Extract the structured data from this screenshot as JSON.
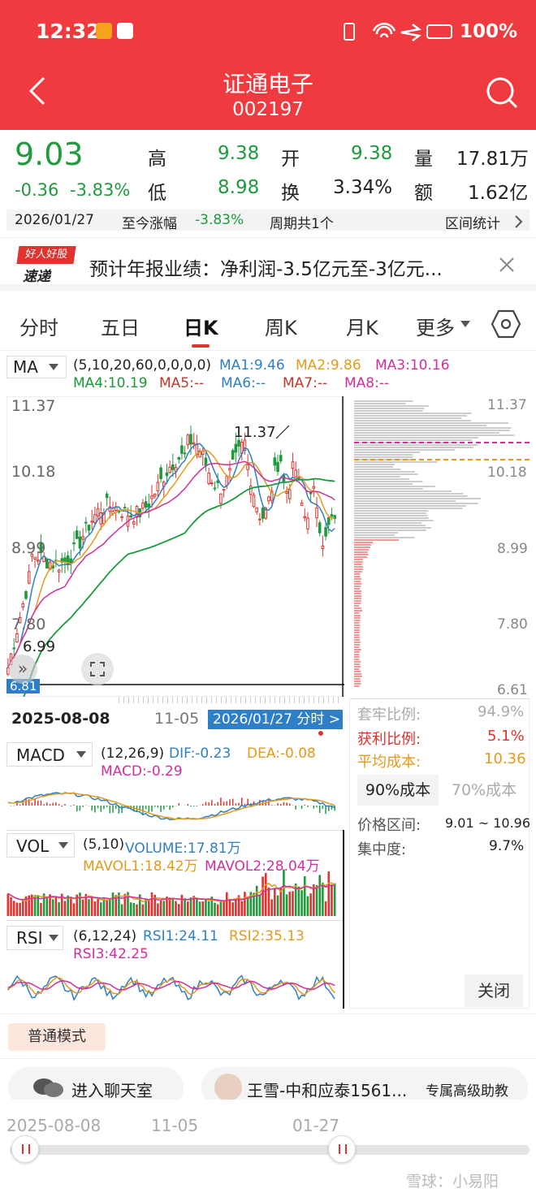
{
  "status": {
    "time": "12:32",
    "battery": "100%"
  },
  "header": {
    "title": "证通电子",
    "code": "002197"
  },
  "quote": {
    "price": "9.03",
    "change": "-0.36",
    "pct": "-3.83%",
    "high_label": "高",
    "high": "9.38",
    "low_label": "低",
    "low": "8.98",
    "open_label": "开",
    "open": "9.38",
    "turnover_label": "换",
    "turnover": "3.34%",
    "volume_label": "量",
    "volume": "17.81万",
    "amount_label": "额",
    "amount": "1.62亿",
    "date": "2026/01/27",
    "since_label": "至今涨幅",
    "since_pct": "-3.83%",
    "period": "周期共1个",
    "range_stats": "区间统计"
  },
  "notice": {
    "logo_top": "好人好股",
    "logo_bottom": "速递",
    "text": "预计年报业绩：净利润-3.5亿元至-3亿元..."
  },
  "tabs": [
    "分时",
    "五日",
    "日K",
    "周K",
    "月K",
    "更多"
  ],
  "ma": {
    "selector": "MA",
    "params": "(5,10,20,60,0,0,0,0)",
    "ma1": "MA1:9.46",
    "ma2": "MA2:9.86",
    "ma3": "MA3:10.16",
    "ma4": "MA4:10.19",
    "ma5": "MA5:--",
    "ma6": "MA6:--",
    "ma7": "MA7:--",
    "ma8": "MA8:--"
  },
  "kchart": {
    "y_labels": [
      "11.37",
      "10.18",
      "8.99",
      "7.80",
      "6.81"
    ],
    "peak_label": "11.37",
    "low_label": "6.99",
    "date_start": "2025-08-08",
    "date_mid": "11-05",
    "date_cursor": "2026/01/27 分时 >"
  },
  "chip": {
    "y_labels": [
      "11.37",
      "10.18",
      "8.99",
      "7.80",
      "6.61"
    ],
    "rows": [
      {
        "k": "套牢比例:",
        "v": "94.9%"
      },
      {
        "k": "获利比例:",
        "v": "5.1%"
      },
      {
        "k": "平均成本:",
        "v": "10.36"
      }
    ],
    "tab1": "90%成本",
    "tab2": "70%成本",
    "range_k": "价格区间:",
    "range_v": "9.01 ~ 10.96",
    "conc_k": "集中度:",
    "conc_v": "9.7%",
    "close": "关闭"
  },
  "macd": {
    "selector": "MACD",
    "params": "(12,26,9)",
    "dif": "DIF:-0.23",
    "dea": "DEA:-0.08",
    "macd": "MACD:-0.29"
  },
  "vol": {
    "selector": "VOL",
    "params": "(5,10)",
    "volume": "VOLUME:17.81万",
    "mavol1": "MAVOL1:18.42万",
    "mavol2": "MAVOL2:28.04万"
  },
  "rsi": {
    "selector": "RSI",
    "params": "(6,12,24)",
    "rsi1": "RSI1:24.11",
    "rsi2": "RSI2:35.13",
    "rsi3": "RSI3:42.25"
  },
  "mode": "普通模式",
  "chat": "进入聊天室",
  "advisor": {
    "name": "王雪-中和应泰1561...",
    "role": "专属高级助教"
  },
  "timeline": {
    "d1": "2025-08-08",
    "d2": "11-05",
    "d3": "01-27"
  },
  "watermark": "雪球：小易阳"
}
